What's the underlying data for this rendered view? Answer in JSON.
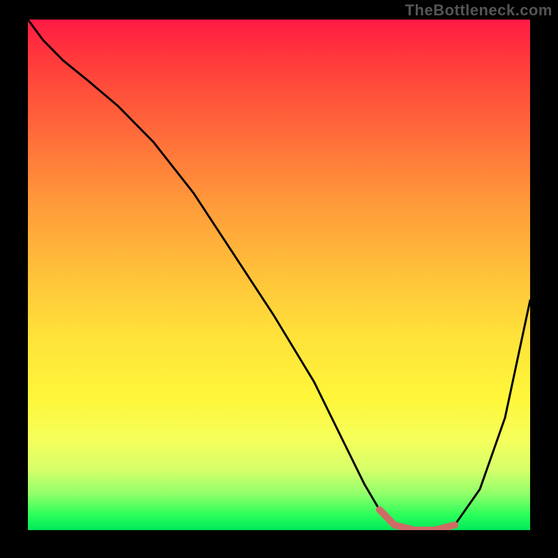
{
  "watermark": "TheBottleneck.com",
  "colors": {
    "frame_bg": "#000000",
    "curve": "#000000",
    "highlight": "#cf6b66"
  },
  "chart_data": {
    "type": "line",
    "title": "",
    "xlabel": "",
    "ylabel": "",
    "xlim": [
      0,
      100
    ],
    "ylim": [
      0,
      100
    ],
    "grid": false,
    "series": [
      {
        "name": "bottleneck-curve",
        "x": [
          0,
          3,
          7,
          12,
          18,
          25,
          33,
          41,
          49,
          57,
          63,
          67,
          70,
          73,
          77,
          81,
          85,
          90,
          95,
          100
        ],
        "y": [
          100,
          96,
          92,
          88,
          83,
          76,
          66,
          54,
          42,
          29,
          17,
          9,
          4,
          1,
          0,
          0,
          1,
          8,
          22,
          45
        ]
      }
    ],
    "highlight_range_x": [
      70,
      85
    ],
    "annotations": []
  }
}
